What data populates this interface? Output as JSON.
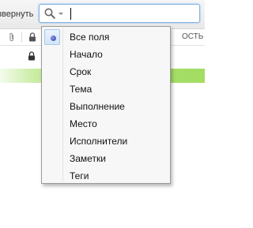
{
  "toolbar": {
    "collapse_label": "звернуть",
    "search": {
      "value": "",
      "placeholder": ""
    }
  },
  "table": {
    "header_partial_label": "ОСТЬ"
  },
  "colors": {
    "highlight_row": "#a4dd64",
    "menu_selection_border": "#a7c6e8",
    "search_focus_border": "#7eb4ea"
  },
  "search_menu": {
    "items": [
      {
        "label": "Все поля",
        "selected": true
      },
      {
        "label": "Начало",
        "selected": false
      },
      {
        "label": "Срок",
        "selected": false
      },
      {
        "label": "Тема",
        "selected": false
      },
      {
        "label": "Выполнение",
        "selected": false
      },
      {
        "label": "Место",
        "selected": false
      },
      {
        "label": "Исполнители",
        "selected": false
      },
      {
        "label": "Заметки",
        "selected": false
      },
      {
        "label": "Теги",
        "selected": false
      }
    ]
  }
}
